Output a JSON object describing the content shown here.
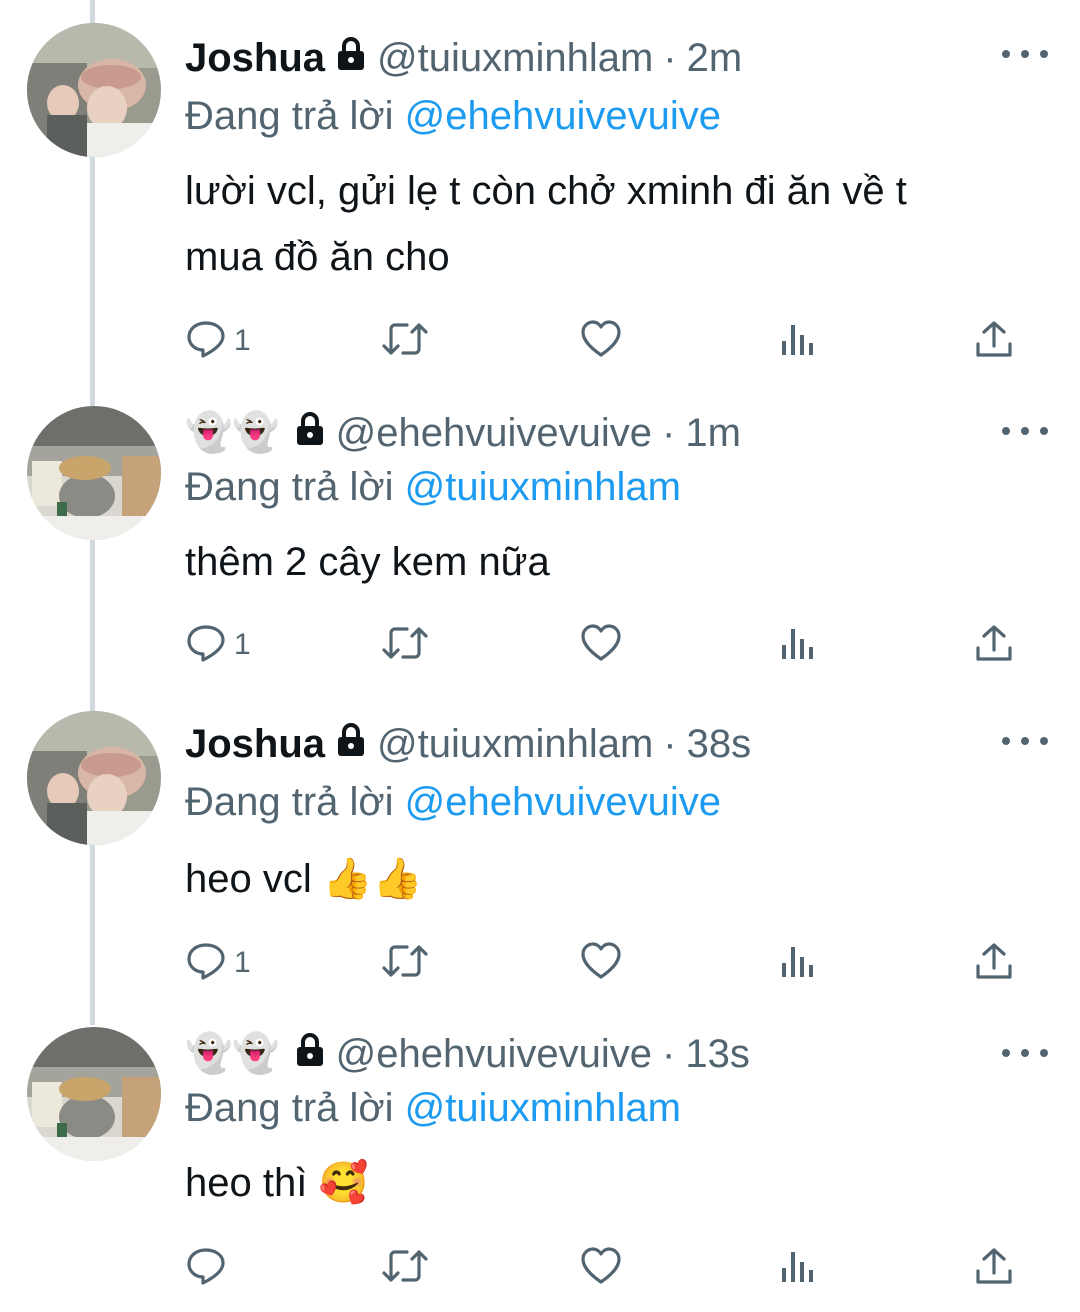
{
  "tweets": [
    {
      "avatar": "avatar-person-cap",
      "name": "Joshua",
      "prefix_emoji": "",
      "handle": "@tuiuxminhlam",
      "time": "2m",
      "replying_label": "Đang trả lời",
      "replying_to": "@ehehvuivevuive",
      "text_lines": [
        "lười vcl, gửi lẹ t còn chở xminh đi ăn về t",
        "mua đồ ăn cho"
      ],
      "reply_count": "1"
    },
    {
      "avatar": "avatar-room-hat",
      "name": "",
      "prefix_emoji": "👻👻",
      "handle": "@ehehvuivevuive",
      "time": "1m",
      "replying_label": "Đang trả lời",
      "replying_to": "@tuiuxminhlam",
      "text_lines": [
        "thêm 2 cây kem nữa"
      ],
      "reply_count": "1"
    },
    {
      "avatar": "avatar-person-cap",
      "name": "Joshua",
      "prefix_emoji": "",
      "handle": "@tuiuxminhlam",
      "time": "38s",
      "replying_label": "Đang trả lời",
      "replying_to": "@ehehvuivevuive",
      "text_lines": [
        "heo vcl 👍👍"
      ],
      "reply_count": "1"
    },
    {
      "avatar": "avatar-room-hat",
      "name": "",
      "prefix_emoji": "👻👻",
      "handle": "@ehehvuivevuive",
      "time": "13s",
      "replying_label": "Đang trả lời",
      "replying_to": "@tuiuxminhlam",
      "text_lines": [
        "heo thì 🥰"
      ],
      "reply_count": ""
    }
  ],
  "icons": {
    "reply": "reply-icon",
    "retweet": "retweet-icon",
    "like": "heart-icon",
    "views": "views-icon",
    "share": "share-icon",
    "more": "more-icon",
    "lock": "lock-icon"
  },
  "colors": {
    "link": "#1d9bf0",
    "secondary_text": "#536471",
    "thread_line": "#cfd9de"
  }
}
